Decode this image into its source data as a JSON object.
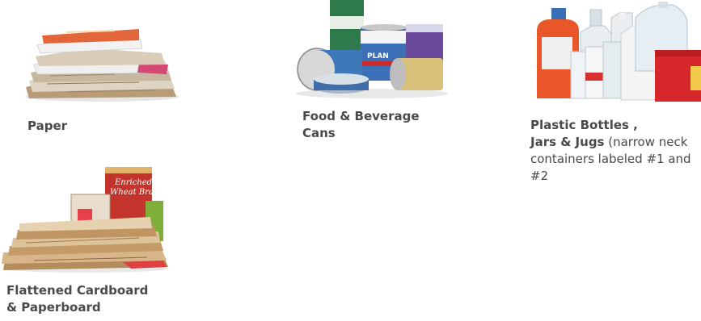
{
  "items": [
    {
      "label_lines": [
        "Paper"
      ],
      "image_icon": "paper-pile-icon"
    },
    {
      "label_lines": [
        "Food & Beverage",
        "Cans"
      ],
      "image_icon": "cans-icon"
    },
    {
      "label_lines": [
        "Plastic Bottles ,"
      ],
      "label_bold_2": "Jars & Jugs",
      "label_rest_2": " (narrow neck",
      "label_rest_3": "containers labeled #1 and",
      "label_rest_4": "#2",
      "image_icon": "plastic-bottles-icon"
    },
    {
      "label_lines": [
        "Flattened Cardboard",
        "& Paperboard"
      ],
      "image_icon": "cardboard-icon",
      "box_text": [
        "Enriched",
        "Wheat Bran"
      ]
    }
  ],
  "can_labels": [
    "PLAN"
  ],
  "colors": {
    "text": "#4a4a4a",
    "orange": "#e8562a",
    "red": "#d6282c",
    "cardboard": "#c9a77c"
  }
}
